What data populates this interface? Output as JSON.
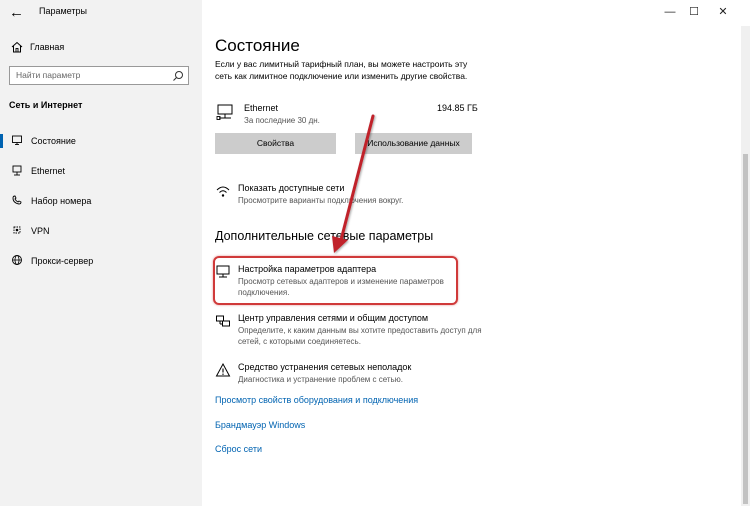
{
  "window": {
    "title": "Параметры",
    "controls": {
      "minimize": "—",
      "maximize": "☐",
      "close": "✕"
    },
    "back": "←"
  },
  "sidebar": {
    "home": "Главная",
    "search_placeholder": "Найти параметр",
    "section": "Сеть и Интернет",
    "items": [
      {
        "label": "Состояние",
        "icon": "status-icon",
        "selected": true
      },
      {
        "label": "Ethernet",
        "icon": "ethernet-icon",
        "selected": false
      },
      {
        "label": "Набор номера",
        "icon": "dialup-icon",
        "selected": false
      },
      {
        "label": "VPN",
        "icon": "vpn-icon",
        "selected": false
      },
      {
        "label": "Прокси-сервер",
        "icon": "globe-icon",
        "selected": false
      }
    ]
  },
  "main": {
    "title": "Состояние",
    "intro": "Если у вас лимитный тарифный план, вы можете настроить эту сеть как лимитное подключение или изменить другие свойства.",
    "connection": {
      "name": "Ethernet",
      "period": "За последние 30 дн.",
      "usage": "194.85 ГБ"
    },
    "buttons": {
      "properties": "Свойства",
      "data_usage": "Использование данных"
    },
    "show_networks": {
      "title": "Показать доступные сети",
      "subtitle": "Просмотрите варианты подключения вокруг."
    },
    "advanced_heading": "Дополнительные сетевые параметры",
    "adapter": {
      "title": "Настройка параметров адаптера",
      "subtitle": "Просмотр сетевых адаптеров и изменение параметров подключения."
    },
    "sharing_center": {
      "title": "Центр управления сетями и общим доступом",
      "subtitle": "Определите, к каким данным вы хотите предоставить доступ для сетей, с которыми соединяетесь."
    },
    "troubleshooter": {
      "title": "Средство устранения сетевых неполадок",
      "subtitle": "Диагностика и устранение проблем с сетью."
    },
    "links": {
      "hardware": "Просмотр свойств оборудования и подключения",
      "firewall": "Брандмауэр Windows",
      "reset": "Сброс сети"
    }
  },
  "colors": {
    "accent": "#0063b1",
    "annotation": "#d03a3a",
    "sidebar_bg": "#f2f2f2"
  }
}
